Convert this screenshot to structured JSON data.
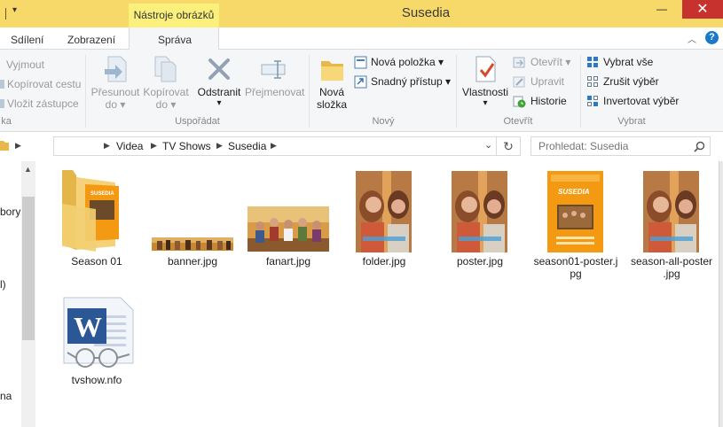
{
  "window": {
    "title": "Susedia",
    "context_tab": "Nástroje obrázků",
    "minimize_glyph": "—",
    "close_glyph": "✕"
  },
  "tabs": {
    "share": "Sdílení",
    "view": "Zobrazení",
    "manage": "Správa"
  },
  "ribbon": {
    "clipboard": {
      "cut": "Vyjmout",
      "copy_path": "Kopírovat cestu",
      "paste_shortcut": "Vložit zástupce",
      "group_label": "ka"
    },
    "organize": {
      "move_to_line1": "Přesunout",
      "move_to_line2": "do",
      "copy_to_line1": "Kopírovat",
      "copy_to_line2": "do",
      "delete": "Odstranit",
      "rename": "Přejmenovat",
      "group_label": "Uspořádat"
    },
    "new": {
      "new_folder_line1": "Nová",
      "new_folder_line2": "složka",
      "new_item": "Nová položka",
      "easy_access": "Snadný přístup",
      "group_label": "Nový"
    },
    "open": {
      "properties": "Vlastnosti",
      "open": "Otevřít",
      "edit": "Upravit",
      "history": "Historie",
      "group_label": "Otevřít"
    },
    "select": {
      "select_all": "Vybrat vše",
      "select_none": "Zrušit výběr",
      "invert": "Invertovat výběr",
      "group_label": "Vybrat"
    }
  },
  "address": {
    "crumbs": [
      "Videa",
      "TV Shows",
      "Susedia"
    ],
    "search_placeholder": "Prohledat: Susedia"
  },
  "nav_pane": {
    "fragments": [
      "bory",
      "l)",
      "na"
    ]
  },
  "files": [
    {
      "name": "Season 01",
      "kind": "folder"
    },
    {
      "name": "banner.jpg",
      "kind": "banner"
    },
    {
      "name": "fanart.jpg",
      "kind": "fanart"
    },
    {
      "name": "folder.jpg",
      "kind": "poster"
    },
    {
      "name": "poster.jpg",
      "kind": "poster"
    },
    {
      "name": "season01-poster.jpg",
      "line1": "season01-poster.j",
      "line2": "pg",
      "kind": "season-poster"
    },
    {
      "name": "season-all-poster.jpg",
      "line1": "season-all-poster",
      "line2": ".jpg",
      "kind": "poster"
    },
    {
      "name": "tvshow.nfo",
      "kind": "word"
    }
  ],
  "thumbnail_text": {
    "poster_title": "SUSEDIA",
    "word_letter": "W"
  },
  "colors": {
    "titlebar": "#f7d969",
    "context_tab": "#fbf07b",
    "close": "#c7322f",
    "poster_orange": "#f49a12"
  }
}
